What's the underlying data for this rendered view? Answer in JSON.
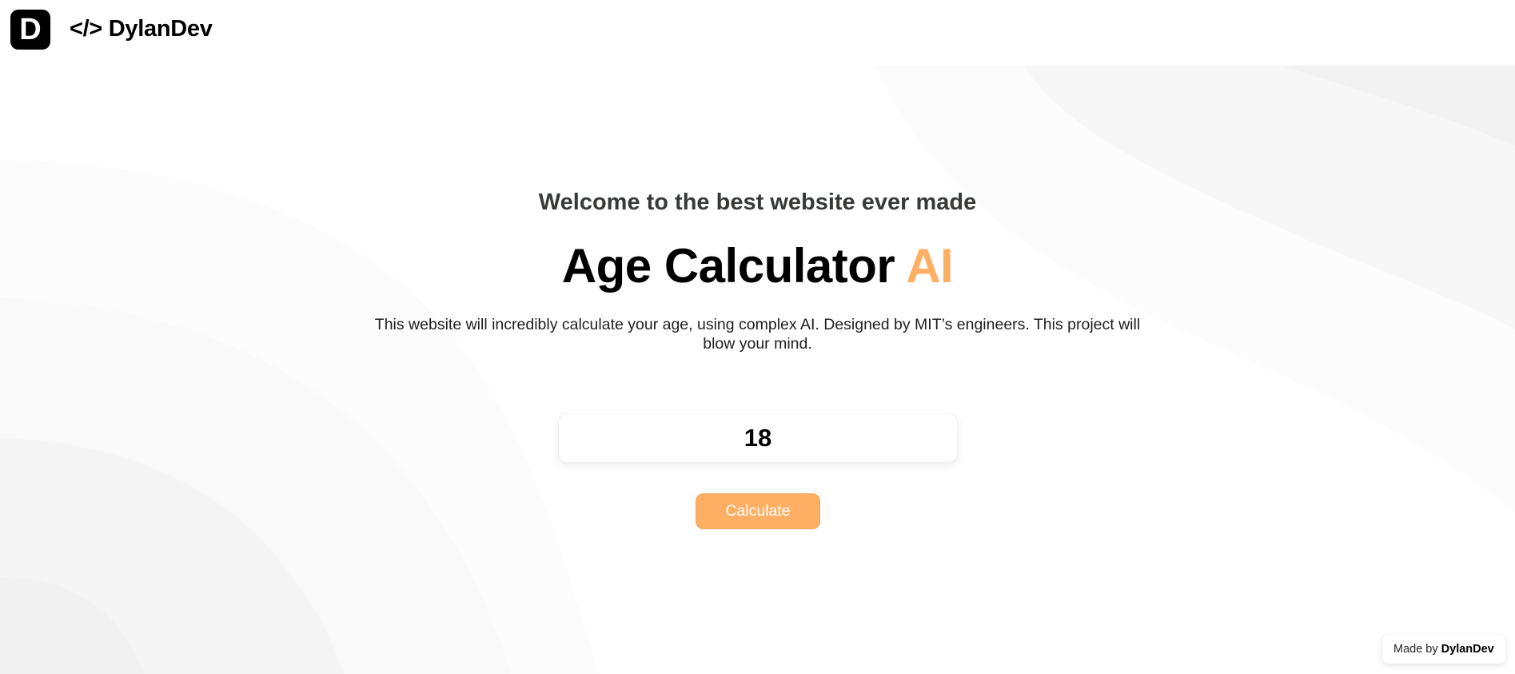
{
  "header": {
    "logo_letter": "D",
    "brand": "</> DylanDev"
  },
  "hero": {
    "welcome": "Welcome to the best website ever made",
    "title_main": "Age Calculator ",
    "title_accent": "AI",
    "description": "This website will incredibly calculate your age, using complex AI. Designed by MIT’s engineers. This project will blow your mind."
  },
  "form": {
    "age_value": "18",
    "calculate_label": "Calculate"
  },
  "footer": {
    "made_by_prefix": "Made by ",
    "made_by_name": "DylanDev"
  },
  "colors": {
    "accent": "#ffaf63",
    "text_dark": "#000000",
    "subtitle": "#373b38",
    "background": "#ffffff"
  }
}
